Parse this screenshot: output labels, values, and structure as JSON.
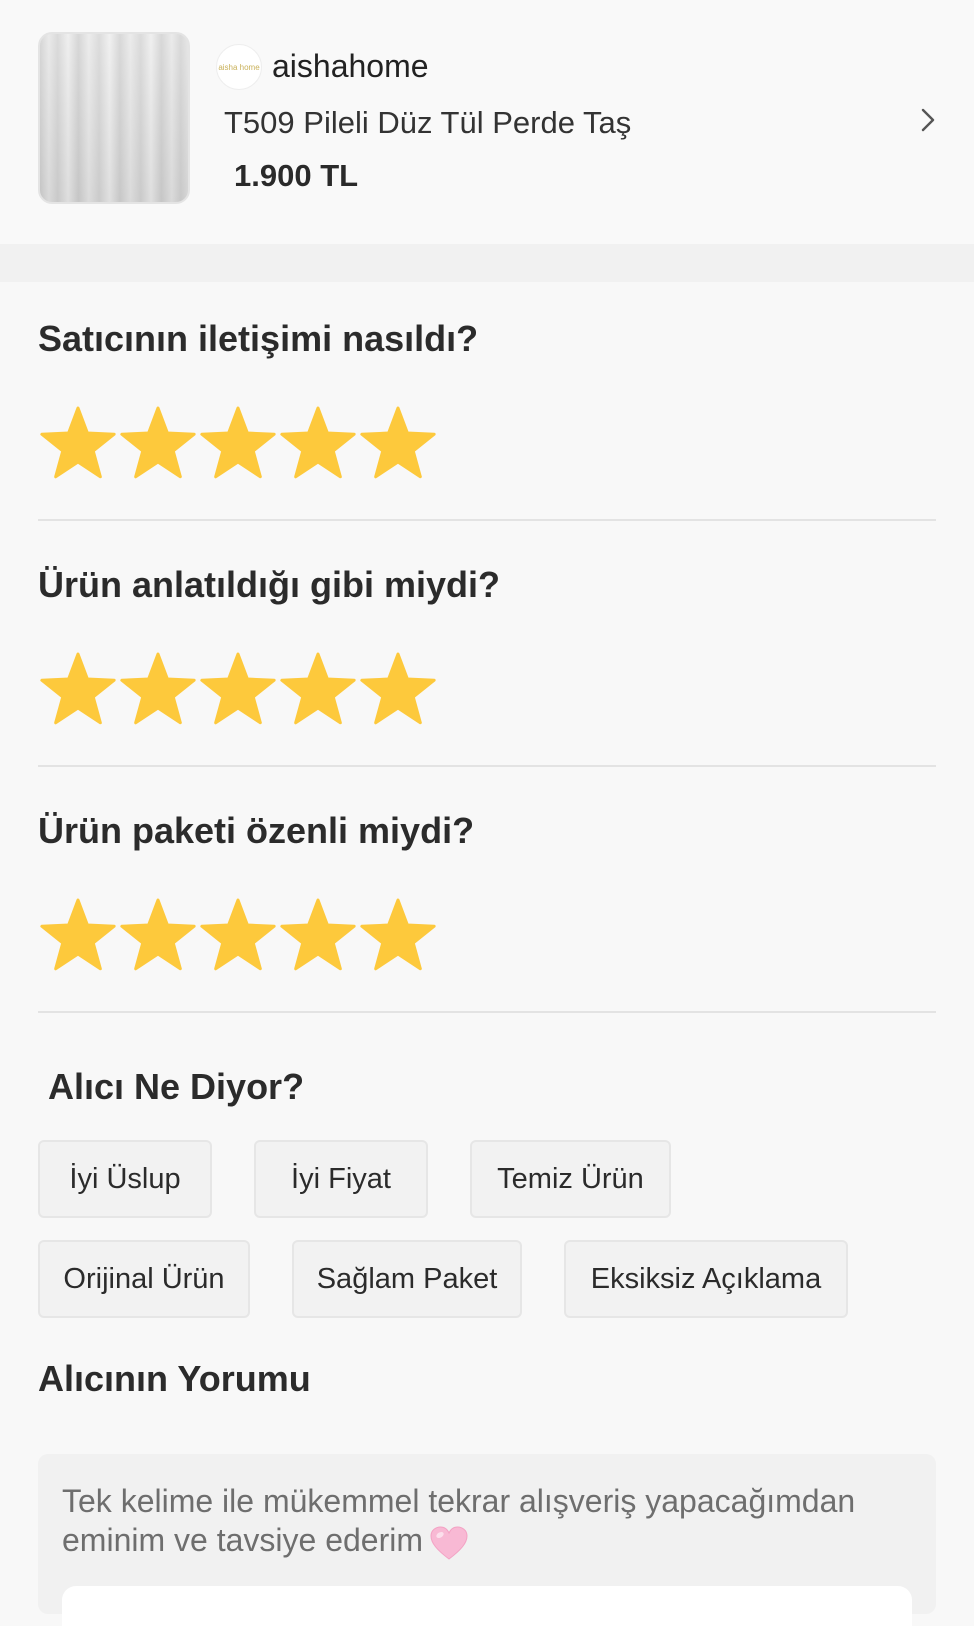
{
  "product": {
    "store_logo_text": "aisha home",
    "store_name": "aishahome",
    "title": "T509 Pileli Düz Tül Perde Taş",
    "price": "1.900 TL"
  },
  "ratings": [
    {
      "question": "Satıcının iletişimi nasıldı?",
      "stars": 5,
      "max": 5
    },
    {
      "question": "Ürün anlatıldığı gibi miydi?",
      "stars": 5,
      "max": 5
    },
    {
      "question": "Ürün paketi özenli miydi?",
      "stars": 5,
      "max": 5
    }
  ],
  "buyer_says": {
    "title": "Alıcı Ne Diyor?",
    "tags": [
      "İyi Üslup",
      "İyi Fiyat",
      "Temiz Ürün",
      "Orijinal Ürün",
      "Sağlam Paket",
      "Eksiksiz Açıklama"
    ]
  },
  "buyer_comment": {
    "title": "Alıcının Yorumu",
    "text": "Tek kelime ile mükemmel tekrar alışveriş yapacağımdan eminim ve tavsiye ederim"
  },
  "colors": {
    "star": "#fdc93c",
    "heart": "#f8b9d4"
  },
  "icons": {
    "chevron": "chevron-right-icon",
    "star": "star-icon",
    "heart": "pink-heart-emoji"
  }
}
